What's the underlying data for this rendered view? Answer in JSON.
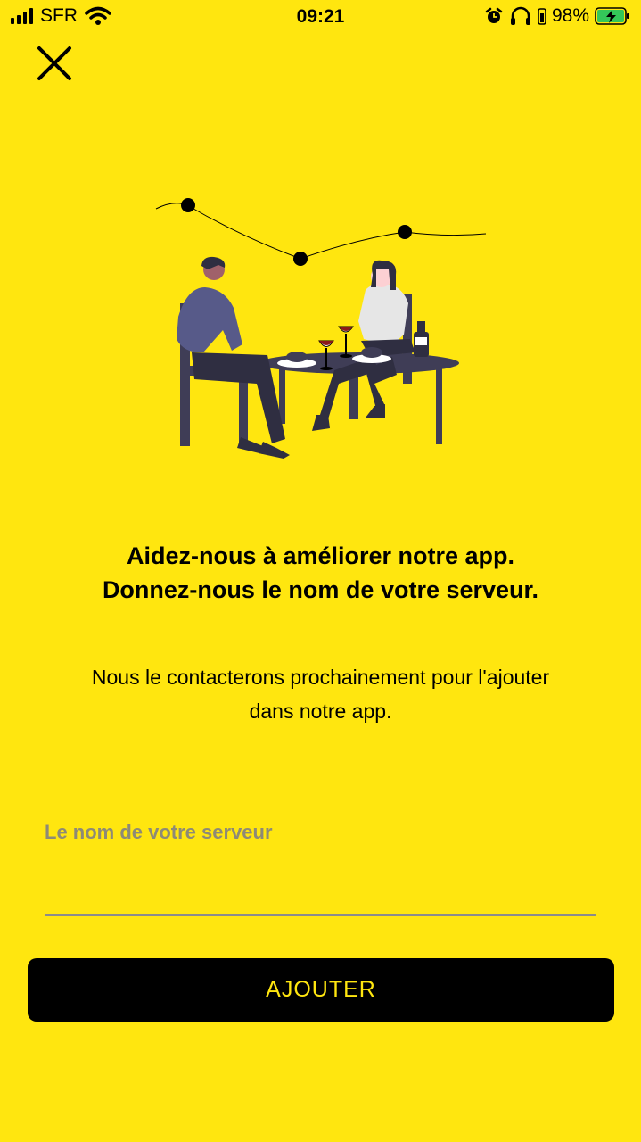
{
  "status_bar": {
    "carrier": "SFR",
    "time": "09:21",
    "battery_percent": "98%",
    "icons": [
      "signal-icon",
      "wifi-icon",
      "alarm-icon",
      "headphones-icon",
      "battery-charging-icon"
    ]
  },
  "header": {
    "close_icon": "close-icon"
  },
  "content": {
    "headline_line1": "Aidez-nous à améliorer notre app.",
    "headline_line2": "Donnez-nous le nom de votre serveur.",
    "subtext_line1": "Nous le contacterons prochainement pour l'ajouter",
    "subtext_line2": "dans notre app."
  },
  "form": {
    "field_label": "Le nom de votre serveur",
    "field_value": "",
    "submit_label": "AJOUTER"
  },
  "colors": {
    "background": "#FFE60F",
    "button": "#000000",
    "button_text": "#FFE60F",
    "label": "#8E8A76"
  }
}
